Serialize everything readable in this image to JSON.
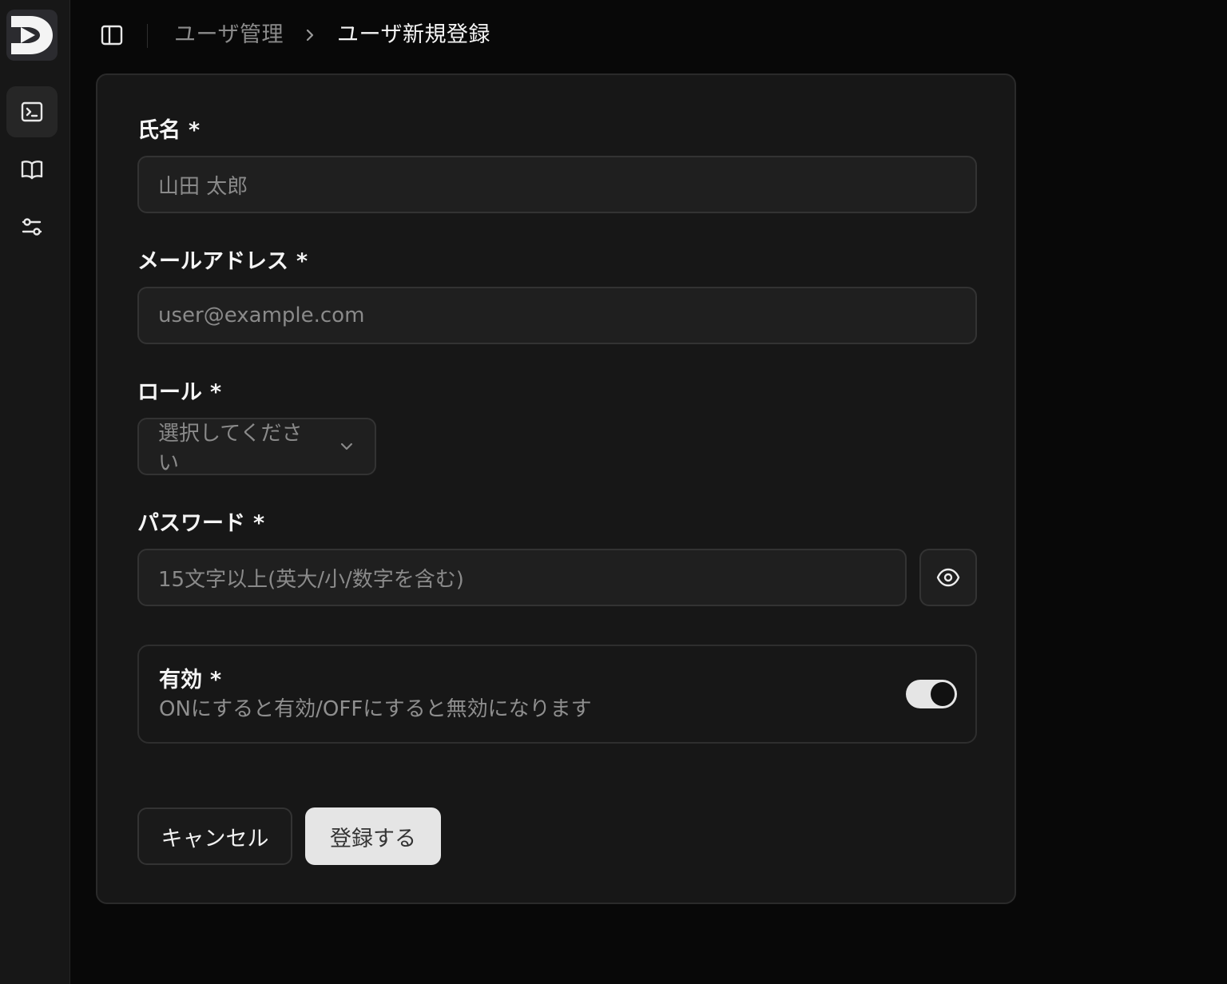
{
  "sidebar": {
    "logo_icon": "d-play-logo",
    "items": [
      {
        "name": "terminal",
        "icon": "terminal-icon",
        "active": true
      },
      {
        "name": "docs",
        "icon": "book-icon",
        "active": false
      },
      {
        "name": "settings",
        "icon": "sliders-icon",
        "active": false
      }
    ]
  },
  "header": {
    "breadcrumb_parent": "ユーザ管理",
    "breadcrumb_separator_icon": "chevron-right-icon",
    "breadcrumb_current": "ユーザ新規登録"
  },
  "form": {
    "name": {
      "label": "氏名",
      "required_mark": "*",
      "placeholder": "山田 太郎"
    },
    "email": {
      "label": "メールアドレス",
      "required_mark": "*",
      "placeholder": "user@example.com"
    },
    "role": {
      "label": "ロール",
      "required_mark": "*",
      "placeholder": "選択してください"
    },
    "password": {
      "label": "パスワード",
      "required_mark": "*",
      "placeholder": "15文字以上(英大/小/数字を含む)"
    },
    "active": {
      "label": "有効",
      "required_mark": "*",
      "description": "ONにすると有効/OFFにすると無効になります",
      "value": true
    },
    "cancel_label": "キャンセル",
    "submit_label": "登録する"
  },
  "colors": {
    "background": "#080808",
    "card": "#171717",
    "input": "#1f1f1f",
    "border": "#333333",
    "primary_button": "#e5e5e5"
  }
}
